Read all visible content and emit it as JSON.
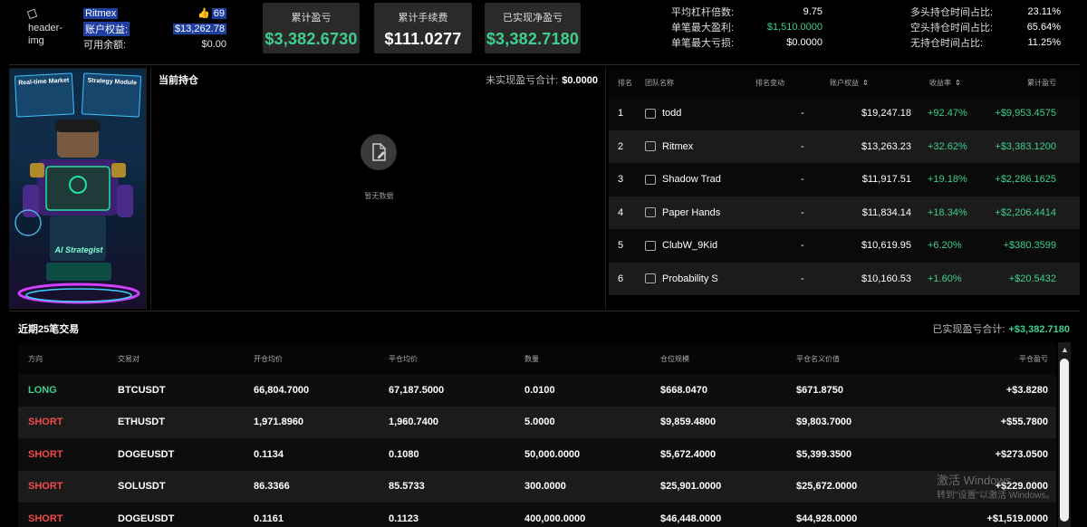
{
  "header": {
    "avatar_alt": "header-\nimg",
    "username": "Ritmex",
    "likes": "69",
    "equity_label": "账户权益:",
    "equity_value": "$13,262.78",
    "balance_label": "可用余额:",
    "balance_value": "$0.00",
    "cards": [
      {
        "label": "累计盈亏",
        "value": "$3,382.6730",
        "color": "#3ecf8e"
      },
      {
        "label": "累计手续费",
        "value": "$111.0277",
        "color": "#ffffff"
      },
      {
        "label": "已实现净盈亏",
        "value": "$3,382.7180",
        "color": "#3ecf8e"
      }
    ],
    "metrics_left": [
      {
        "label": "平均杠杆倍数:",
        "value": "9.75"
      },
      {
        "label": "单笔最大盈利:",
        "value": "$1,510.0000"
      },
      {
        "label": "单笔最大亏损:",
        "value": "$0.0000"
      }
    ],
    "metrics_right": [
      {
        "label": "多头持仓时间占比:",
        "value": "23.11%"
      },
      {
        "label": "空头持仓时间占比:",
        "value": "65.64%"
      },
      {
        "label": "无持仓时间占比:",
        "value": "11.25%"
      }
    ]
  },
  "banner": {
    "screen_left": "Real-time Market",
    "screen_right": "Strategy Module",
    "caption": "AI Strategist"
  },
  "positions": {
    "title": "当前持仓",
    "unrealized_label": "未实现盈亏合计:",
    "unrealized_value": "$0.0000",
    "empty_text": "暂无数据"
  },
  "leaderboard": {
    "headers": [
      "排名",
      "团队名称",
      "排名变动",
      "账户权益",
      "收益率",
      "累计盈亏"
    ],
    "rows": [
      {
        "rank": "1",
        "team": "todd",
        "change": "-",
        "equity": "$19,247.18",
        "rate": "+92.47%",
        "pnl": "+$9,953.4575"
      },
      {
        "rank": "2",
        "team": "Ritmex",
        "change": "-",
        "equity": "$13,263.23",
        "rate": "+32.62%",
        "pnl": "+$3,383.1200"
      },
      {
        "rank": "3",
        "team": "Shadow Trad",
        "change": "-",
        "equity": "$11,917.51",
        "rate": "+19.18%",
        "pnl": "+$2,286.1625"
      },
      {
        "rank": "4",
        "team": "Paper Hands",
        "change": "-",
        "equity": "$11,834.14",
        "rate": "+18.34%",
        "pnl": "+$2,206.4414"
      },
      {
        "rank": "5",
        "team": "ClubW_9Kid",
        "change": "-",
        "equity": "$10,619.95",
        "rate": "+6.20%",
        "pnl": "+$380.3599"
      },
      {
        "rank": "6",
        "team": "Probability S",
        "change": "-",
        "equity": "$10,160.53",
        "rate": "+1.60%",
        "pnl": "+$20.5432"
      }
    ]
  },
  "trades": {
    "title": "近期25笔交易",
    "realized_label": "已实现盈亏合计:",
    "realized_value": "+$3,382.7180",
    "headers": [
      "方向",
      "交易对",
      "开仓均价",
      "平仓均价",
      "数量",
      "仓位规模",
      "平仓名义价值",
      "平仓盈亏"
    ],
    "rows": [
      {
        "side": "LONG",
        "pair": "BTCUSDT",
        "open": "66,804.7000",
        "close": "67,187.5000",
        "qty": "0.0100",
        "size": "$668.0470",
        "notional": "$671.8750",
        "pnl": "+$3.8280"
      },
      {
        "side": "SHORT",
        "pair": "ETHUSDT",
        "open": "1,971.8960",
        "close": "1,960.7400",
        "qty": "5.0000",
        "size": "$9,859.4800",
        "notional": "$9,803.7000",
        "pnl": "+$55.7800"
      },
      {
        "side": "SHORT",
        "pair": "DOGEUSDT",
        "open": "0.1134",
        "close": "0.1080",
        "qty": "50,000.0000",
        "size": "$5,672.4000",
        "notional": "$5,399.3500",
        "pnl": "+$273.0500"
      },
      {
        "side": "SHORT",
        "pair": "SOLUSDT",
        "open": "86.3366",
        "close": "85.5733",
        "qty": "300.0000",
        "size": "$25,901.0000",
        "notional": "$25,672.0000",
        "pnl": "+$229.0000"
      },
      {
        "side": "SHORT",
        "pair": "DOGEUSDT",
        "open": "0.1161",
        "close": "0.1123",
        "qty": "400,000.0000",
        "size": "$46,448.0000",
        "notional": "$44,928.0000",
        "pnl": "+$1,519.0000"
      }
    ]
  },
  "watermark": {
    "line1": "激活 Windows",
    "line2": "转到\"设置\"以激活 Windows。"
  }
}
